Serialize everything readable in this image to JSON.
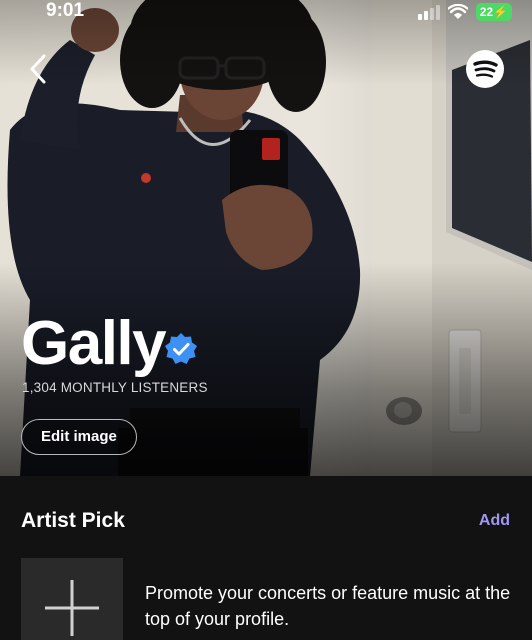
{
  "status_bar": {
    "time": "9:01",
    "battery": "22"
  },
  "icons": {
    "back": "chevron-left-icon",
    "spotify": "spotify-logo-icon",
    "verified": "verified-check-icon",
    "add_tile": "plus-icon"
  },
  "artist": {
    "name": "Gally",
    "monthly_listeners": "1,304 MONTHLY LISTENERS",
    "edit_image_label": "Edit image"
  },
  "artist_pick": {
    "title": "Artist Pick",
    "add_label": "Add",
    "promo_text": "Promote your concerts or feature music at the top of your profile."
  },
  "colors": {
    "background": "#121212",
    "accent_add": "#9e97f5",
    "verified_blue": "#3d91f4",
    "battery_green": "#4cd964"
  }
}
